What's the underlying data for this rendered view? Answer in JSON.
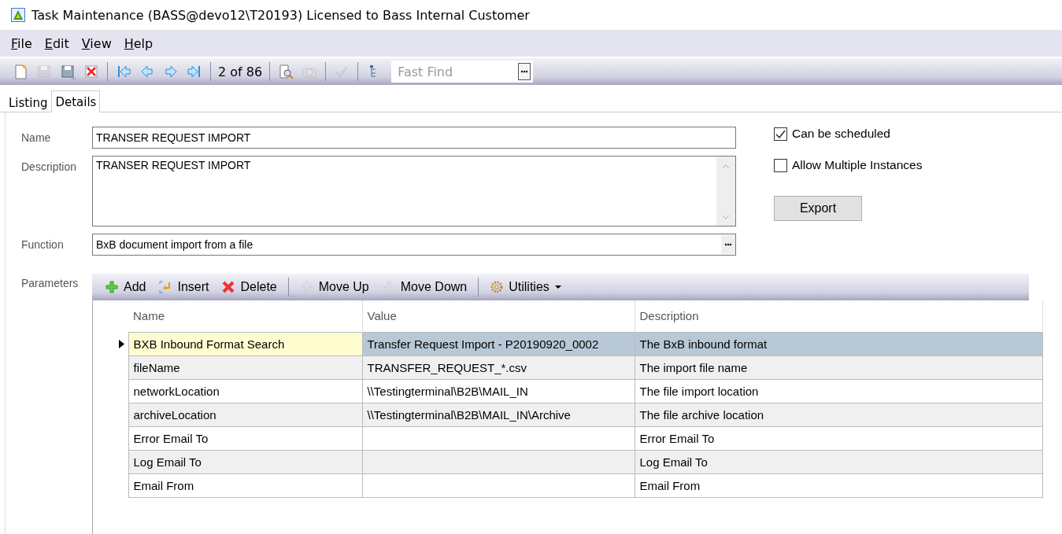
{
  "window": {
    "title": "Task Maintenance (BASS@devo12\\T20193) Licensed to Bass Internal Customer"
  },
  "menu": [
    {
      "accel": "F",
      "rest": "ile"
    },
    {
      "accel": "E",
      "rest": "dit"
    },
    {
      "accel": "V",
      "rest": "iew"
    },
    {
      "accel": "H",
      "rest": "elp"
    }
  ],
  "toolbar": {
    "items": [
      {
        "kind": "new",
        "disabled": false
      },
      {
        "kind": "save",
        "disabled": true
      },
      {
        "kind": "save-as",
        "disabled": false
      },
      {
        "kind": "delete",
        "disabled": false
      },
      {
        "kind": "sep"
      },
      {
        "kind": "first",
        "disabled": false
      },
      {
        "kind": "prev",
        "disabled": false
      },
      {
        "kind": "next",
        "disabled": false
      },
      {
        "kind": "last",
        "disabled": false
      },
      {
        "kind": "sep"
      }
    ],
    "position": "2 of 86",
    "items2": [
      {
        "kind": "preview",
        "disabled": false
      },
      {
        "kind": "camera",
        "disabled": true
      },
      {
        "kind": "sep"
      },
      {
        "kind": "approve",
        "disabled": true
      },
      {
        "kind": "sep"
      },
      {
        "kind": "tree",
        "disabled": false
      }
    ],
    "fast_find": {
      "placeholder": "Fast Find"
    }
  },
  "tabs": [
    {
      "label": "Listing",
      "selected": false
    },
    {
      "label": "Details",
      "selected": true
    }
  ],
  "form": {
    "name_label": "Name",
    "name": "TRANSER REQUEST IMPORT",
    "description_label": "Description",
    "description": "TRANSER REQUEST IMPORT",
    "function_label": "Function",
    "function": "BxB document import from a file",
    "checks": [
      {
        "label": "Can be scheduled",
        "checked": true
      },
      {
        "label": "Allow Multiple Instances",
        "checked": false
      }
    ],
    "export_button": "Export"
  },
  "parameters": {
    "label": "Parameters",
    "toolbar": [
      {
        "kind": "add",
        "label": "Add",
        "disabled": false
      },
      {
        "kind": "insert",
        "label": "Insert",
        "disabled": false
      },
      {
        "kind": "delete",
        "label": "Delete",
        "disabled": false
      },
      {
        "kind": "sep"
      },
      {
        "kind": "up",
        "label": "Move Up",
        "disabled": true
      },
      {
        "kind": "down",
        "label": "Move Down",
        "disabled": true
      },
      {
        "kind": "sep"
      },
      {
        "kind": "utilities",
        "label": "Utilities",
        "disabled": false
      }
    ],
    "columns": [
      "Name",
      "Value",
      "Description"
    ],
    "rows": [
      {
        "selected": true,
        "cells": [
          "BXB Inbound Format Search",
          "Transfer Request Import - P20190920_0002",
          "The BxB inbound format"
        ]
      },
      {
        "selected": false,
        "cells": [
          "fileName",
          "TRANSFER_REQUEST_*.csv",
          "The import file name"
        ]
      },
      {
        "selected": false,
        "cells": [
          "networkLocation",
          "\\\\Testingterminal\\B2B\\MAIL_IN",
          "The file import location"
        ]
      },
      {
        "selected": false,
        "cells": [
          "archiveLocation",
          "\\\\Testingterminal\\B2B\\MAIL_IN\\Archive",
          "The file archive location"
        ]
      },
      {
        "selected": false,
        "cells": [
          "Error Email To",
          "",
          "Error Email To"
        ]
      },
      {
        "selected": false,
        "cells": [
          "Log Email To",
          "",
          "Log Email To"
        ]
      },
      {
        "selected": false,
        "cells": [
          "Email From",
          "",
          "Email From"
        ]
      }
    ]
  }
}
